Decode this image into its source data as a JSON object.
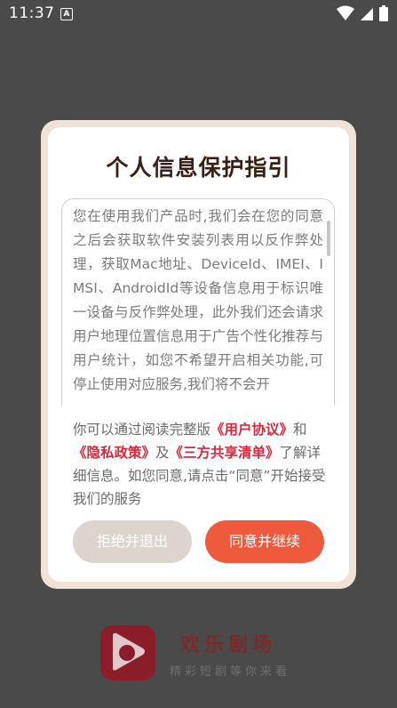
{
  "status_bar": {
    "time": "11:37",
    "notification_glyph": "A"
  },
  "dialog": {
    "title": "个人信息保护指引",
    "policy_text": "您在使用我们产品时,我们会在您的同意之后会获取软件安装列表用以反作弊处理，获取Mac地址、DeviceId、IMEI、IMSI、AndroidId等设备信息用于标识唯一设备与反作弊处理，此外我们还会请求用户地理位置信息用于广告个性化推荐与用户统计，如您不希望开启相关功能,可停止使用对应服务,我们将不会开",
    "info": {
      "prefix": "你可以通过阅读完整版",
      "link_user_agreement": "《用户协议》",
      "and": "和",
      "link_privacy": "《隐私政策》",
      "conj": "及",
      "link_third_party": "《三方共享清单》",
      "suffix": "了解详细信息。如您同意,请点击“同意”开始接受我们的服务"
    },
    "reject_label": "拒绝并退出",
    "agree_label": "同意并继续"
  },
  "brand": {
    "name": "欢乐剧场",
    "slogan": "精彩短剧等你来看"
  },
  "colors": {
    "accent": "#ef5a3d",
    "link": "#d6283a",
    "title": "#3a1f17",
    "reject_bg": "#dbd5ce"
  }
}
